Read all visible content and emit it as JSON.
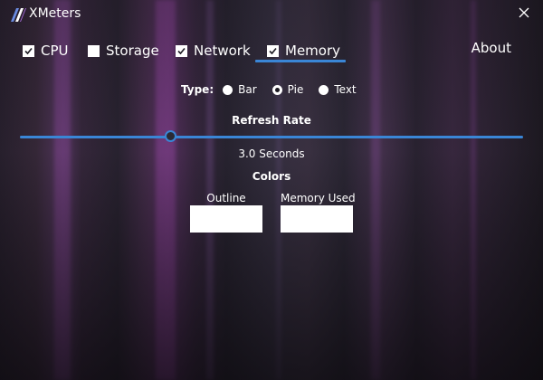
{
  "window": {
    "title": "XMeters",
    "close_icon": "close-icon"
  },
  "tabs": [
    {
      "label": "CPU",
      "checked": true
    },
    {
      "label": "Storage",
      "checked": false
    },
    {
      "label": "Network",
      "checked": true
    },
    {
      "label": "Memory",
      "checked": true,
      "selected": true
    }
  ],
  "about_label": "About",
  "type": {
    "label": "Type:",
    "options": [
      {
        "label": "Bar",
        "selected": false
      },
      {
        "label": "Pie",
        "selected": true
      },
      {
        "label": "Text",
        "selected": false
      }
    ]
  },
  "refresh": {
    "title": "Refresh Rate",
    "value_text": "3.0 Seconds",
    "fraction": 0.298
  },
  "colors": {
    "title": "Colors",
    "outline": {
      "label": "Outline",
      "color": "#ffffff"
    },
    "used": {
      "label": "Memory Used",
      "color": "#ffffff"
    }
  },
  "theme": {
    "accent": "#3a86d6"
  }
}
